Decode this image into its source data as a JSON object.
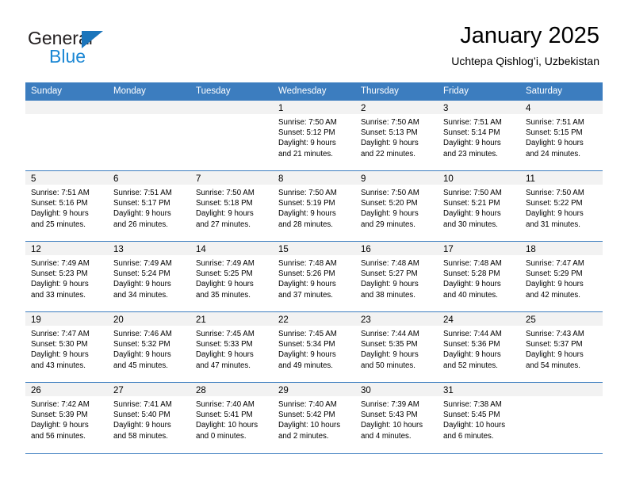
{
  "brand": {
    "line1": "General",
    "line2": "Blue",
    "triangle_color": "#1b75bb",
    "text_color": "#231f20",
    "accent_color": "#1b87d4"
  },
  "header": {
    "title": "January 2025",
    "subtitle": "Uchtepa Qishlog’i, Uzbekistan"
  },
  "calendar": {
    "header_bg": "#3c7dbf",
    "daynum_bg": "#f2f2f2",
    "weekday_headers": [
      "Sunday",
      "Monday",
      "Tuesday",
      "Wednesday",
      "Thursday",
      "Friday",
      "Saturday"
    ],
    "weeks": [
      [
        {
          "day": "",
          "empty": true,
          "sunrise": "",
          "sunset": "",
          "daylight1": "",
          "daylight2": ""
        },
        {
          "day": "",
          "empty": true,
          "sunrise": "",
          "sunset": "",
          "daylight1": "",
          "daylight2": ""
        },
        {
          "day": "",
          "empty": true,
          "sunrise": "",
          "sunset": "",
          "daylight1": "",
          "daylight2": ""
        },
        {
          "day": "1",
          "empty": false,
          "sunrise": "Sunrise: 7:50 AM",
          "sunset": "Sunset: 5:12 PM",
          "daylight1": "Daylight: 9 hours",
          "daylight2": "and 21 minutes."
        },
        {
          "day": "2",
          "empty": false,
          "sunrise": "Sunrise: 7:50 AM",
          "sunset": "Sunset: 5:13 PM",
          "daylight1": "Daylight: 9 hours",
          "daylight2": "and 22 minutes."
        },
        {
          "day": "3",
          "empty": false,
          "sunrise": "Sunrise: 7:51 AM",
          "sunset": "Sunset: 5:14 PM",
          "daylight1": "Daylight: 9 hours",
          "daylight2": "and 23 minutes."
        },
        {
          "day": "4",
          "empty": false,
          "sunrise": "Sunrise: 7:51 AM",
          "sunset": "Sunset: 5:15 PM",
          "daylight1": "Daylight: 9 hours",
          "daylight2": "and 24 minutes."
        }
      ],
      [
        {
          "day": "5",
          "empty": false,
          "sunrise": "Sunrise: 7:51 AM",
          "sunset": "Sunset: 5:16 PM",
          "daylight1": "Daylight: 9 hours",
          "daylight2": "and 25 minutes."
        },
        {
          "day": "6",
          "empty": false,
          "sunrise": "Sunrise: 7:51 AM",
          "sunset": "Sunset: 5:17 PM",
          "daylight1": "Daylight: 9 hours",
          "daylight2": "and 26 minutes."
        },
        {
          "day": "7",
          "empty": false,
          "sunrise": "Sunrise: 7:50 AM",
          "sunset": "Sunset: 5:18 PM",
          "daylight1": "Daylight: 9 hours",
          "daylight2": "and 27 minutes."
        },
        {
          "day": "8",
          "empty": false,
          "sunrise": "Sunrise: 7:50 AM",
          "sunset": "Sunset: 5:19 PM",
          "daylight1": "Daylight: 9 hours",
          "daylight2": "and 28 minutes."
        },
        {
          "day": "9",
          "empty": false,
          "sunrise": "Sunrise: 7:50 AM",
          "sunset": "Sunset: 5:20 PM",
          "daylight1": "Daylight: 9 hours",
          "daylight2": "and 29 minutes."
        },
        {
          "day": "10",
          "empty": false,
          "sunrise": "Sunrise: 7:50 AM",
          "sunset": "Sunset: 5:21 PM",
          "daylight1": "Daylight: 9 hours",
          "daylight2": "and 30 minutes."
        },
        {
          "day": "11",
          "empty": false,
          "sunrise": "Sunrise: 7:50 AM",
          "sunset": "Sunset: 5:22 PM",
          "daylight1": "Daylight: 9 hours",
          "daylight2": "and 31 minutes."
        }
      ],
      [
        {
          "day": "12",
          "empty": false,
          "sunrise": "Sunrise: 7:49 AM",
          "sunset": "Sunset: 5:23 PM",
          "daylight1": "Daylight: 9 hours",
          "daylight2": "and 33 minutes."
        },
        {
          "day": "13",
          "empty": false,
          "sunrise": "Sunrise: 7:49 AM",
          "sunset": "Sunset: 5:24 PM",
          "daylight1": "Daylight: 9 hours",
          "daylight2": "and 34 minutes."
        },
        {
          "day": "14",
          "empty": false,
          "sunrise": "Sunrise: 7:49 AM",
          "sunset": "Sunset: 5:25 PM",
          "daylight1": "Daylight: 9 hours",
          "daylight2": "and 35 minutes."
        },
        {
          "day": "15",
          "empty": false,
          "sunrise": "Sunrise: 7:48 AM",
          "sunset": "Sunset: 5:26 PM",
          "daylight1": "Daylight: 9 hours",
          "daylight2": "and 37 minutes."
        },
        {
          "day": "16",
          "empty": false,
          "sunrise": "Sunrise: 7:48 AM",
          "sunset": "Sunset: 5:27 PM",
          "daylight1": "Daylight: 9 hours",
          "daylight2": "and 38 minutes."
        },
        {
          "day": "17",
          "empty": false,
          "sunrise": "Sunrise: 7:48 AM",
          "sunset": "Sunset: 5:28 PM",
          "daylight1": "Daylight: 9 hours",
          "daylight2": "and 40 minutes."
        },
        {
          "day": "18",
          "empty": false,
          "sunrise": "Sunrise: 7:47 AM",
          "sunset": "Sunset: 5:29 PM",
          "daylight1": "Daylight: 9 hours",
          "daylight2": "and 42 minutes."
        }
      ],
      [
        {
          "day": "19",
          "empty": false,
          "sunrise": "Sunrise: 7:47 AM",
          "sunset": "Sunset: 5:30 PM",
          "daylight1": "Daylight: 9 hours",
          "daylight2": "and 43 minutes."
        },
        {
          "day": "20",
          "empty": false,
          "sunrise": "Sunrise: 7:46 AM",
          "sunset": "Sunset: 5:32 PM",
          "daylight1": "Daylight: 9 hours",
          "daylight2": "and 45 minutes."
        },
        {
          "day": "21",
          "empty": false,
          "sunrise": "Sunrise: 7:45 AM",
          "sunset": "Sunset: 5:33 PM",
          "daylight1": "Daylight: 9 hours",
          "daylight2": "and 47 minutes."
        },
        {
          "day": "22",
          "empty": false,
          "sunrise": "Sunrise: 7:45 AM",
          "sunset": "Sunset: 5:34 PM",
          "daylight1": "Daylight: 9 hours",
          "daylight2": "and 49 minutes."
        },
        {
          "day": "23",
          "empty": false,
          "sunrise": "Sunrise: 7:44 AM",
          "sunset": "Sunset: 5:35 PM",
          "daylight1": "Daylight: 9 hours",
          "daylight2": "and 50 minutes."
        },
        {
          "day": "24",
          "empty": false,
          "sunrise": "Sunrise: 7:44 AM",
          "sunset": "Sunset: 5:36 PM",
          "daylight1": "Daylight: 9 hours",
          "daylight2": "and 52 minutes."
        },
        {
          "day": "25",
          "empty": false,
          "sunrise": "Sunrise: 7:43 AM",
          "sunset": "Sunset: 5:37 PM",
          "daylight1": "Daylight: 9 hours",
          "daylight2": "and 54 minutes."
        }
      ],
      [
        {
          "day": "26",
          "empty": false,
          "sunrise": "Sunrise: 7:42 AM",
          "sunset": "Sunset: 5:39 PM",
          "daylight1": "Daylight: 9 hours",
          "daylight2": "and 56 minutes."
        },
        {
          "day": "27",
          "empty": false,
          "sunrise": "Sunrise: 7:41 AM",
          "sunset": "Sunset: 5:40 PM",
          "daylight1": "Daylight: 9 hours",
          "daylight2": "and 58 minutes."
        },
        {
          "day": "28",
          "empty": false,
          "sunrise": "Sunrise: 7:40 AM",
          "sunset": "Sunset: 5:41 PM",
          "daylight1": "Daylight: 10 hours",
          "daylight2": "and 0 minutes."
        },
        {
          "day": "29",
          "empty": false,
          "sunrise": "Sunrise: 7:40 AM",
          "sunset": "Sunset: 5:42 PM",
          "daylight1": "Daylight: 10 hours",
          "daylight2": "and 2 minutes."
        },
        {
          "day": "30",
          "empty": false,
          "sunrise": "Sunrise: 7:39 AM",
          "sunset": "Sunset: 5:43 PM",
          "daylight1": "Daylight: 10 hours",
          "daylight2": "and 4 minutes."
        },
        {
          "day": "31",
          "empty": false,
          "sunrise": "Sunrise: 7:38 AM",
          "sunset": "Sunset: 5:45 PM",
          "daylight1": "Daylight: 10 hours",
          "daylight2": "and 6 minutes."
        },
        {
          "day": "",
          "empty": true,
          "sunrise": "",
          "sunset": "",
          "daylight1": "",
          "daylight2": ""
        }
      ]
    ]
  }
}
